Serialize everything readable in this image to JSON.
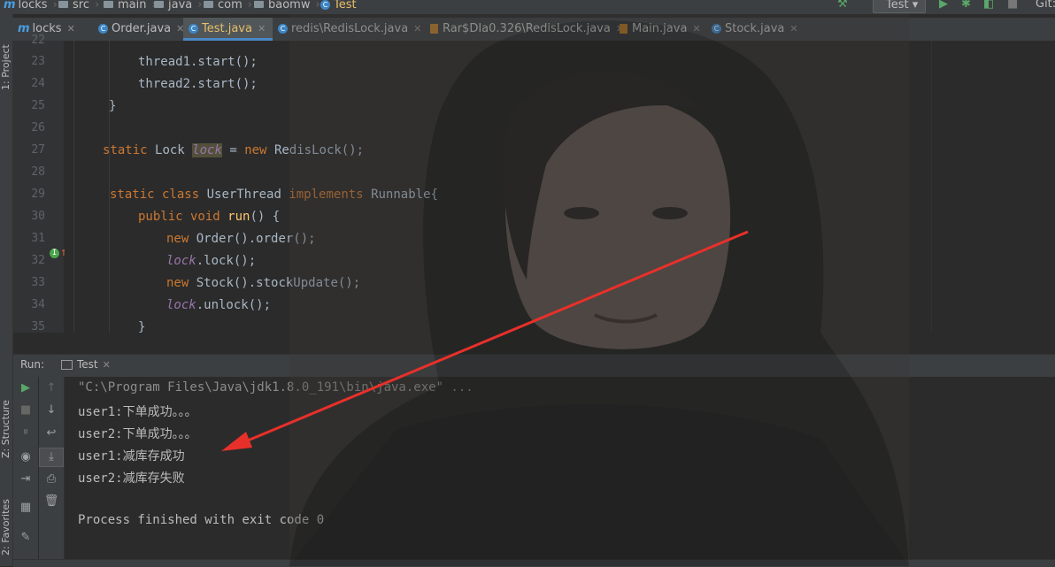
{
  "navbar": {
    "crumbs": [
      "locks",
      "src",
      "main",
      "java",
      "com",
      "baomw",
      "Test"
    ],
    "run_config": "Test",
    "git_label": "Git:"
  },
  "tabs": [
    {
      "label": "locks",
      "kind": "module",
      "active": false
    },
    {
      "label": "Order.java",
      "kind": "class",
      "active": false
    },
    {
      "label": "Test.java",
      "kind": "class",
      "active": true
    },
    {
      "label": "redis\\RedisLock.java",
      "kind": "class",
      "active": false
    },
    {
      "label": "Rar$DIa0.326\\RedisLock.java",
      "kind": "file",
      "active": false
    },
    {
      "label": "Main.java",
      "kind": "file",
      "active": false
    },
    {
      "label": "Stock.java",
      "kind": "class",
      "active": false
    }
  ],
  "sidebar": {
    "project": "1: Project",
    "structure": "Z: Structure",
    "favorites": "2: Favorites"
  },
  "editor": {
    "line_numbers": [
      "22",
      "23",
      "24",
      "25",
      "26",
      "27",
      "28",
      "29",
      "30",
      "31",
      "32",
      "33",
      "34",
      "35"
    ],
    "code": {
      "l23": "thread1.start();",
      "l24": "thread2.start();",
      "l25": "}",
      "l27_static": "static",
      "l27_type": "Lock",
      "l27_var": "lock",
      "l27_eq": "=",
      "l27_new": "new",
      "l27_ctor": "RedisLock();",
      "l29_static": "static class",
      "l29_name": "UserThread",
      "l29_impl": "implements",
      "l29_iface": "Runnable{",
      "l30_mod": "public void",
      "l30_fn": "run",
      "l30_rest": "() {",
      "l31_new": "new",
      "l31_rest": "Order().order();",
      "l32_var": "lock",
      "l32_rest": ".lock();",
      "l33_new": "new",
      "l33_rest": "Stock().stockUpdate();",
      "l34_var": "lock",
      "l34_rest": ".unlock();",
      "l35": "}"
    }
  },
  "run_panel": {
    "label": "Run:",
    "tab": "Test",
    "output": [
      "\"C:\\Program Files\\Java\\jdk1.8.0_191\\bin\\java.exe\" ...",
      "user1:下单成功。。。",
      "user2:下单成功。。。",
      "user1:减库存成功",
      "user2:减库存失败",
      "",
      "Process finished with exit code 0"
    ]
  },
  "colors": {
    "background": "#2b2b2b",
    "keyword": "#cc7832",
    "static_field": "#9876aa",
    "method": "#ffc66d",
    "arrow": "#e8302a"
  }
}
